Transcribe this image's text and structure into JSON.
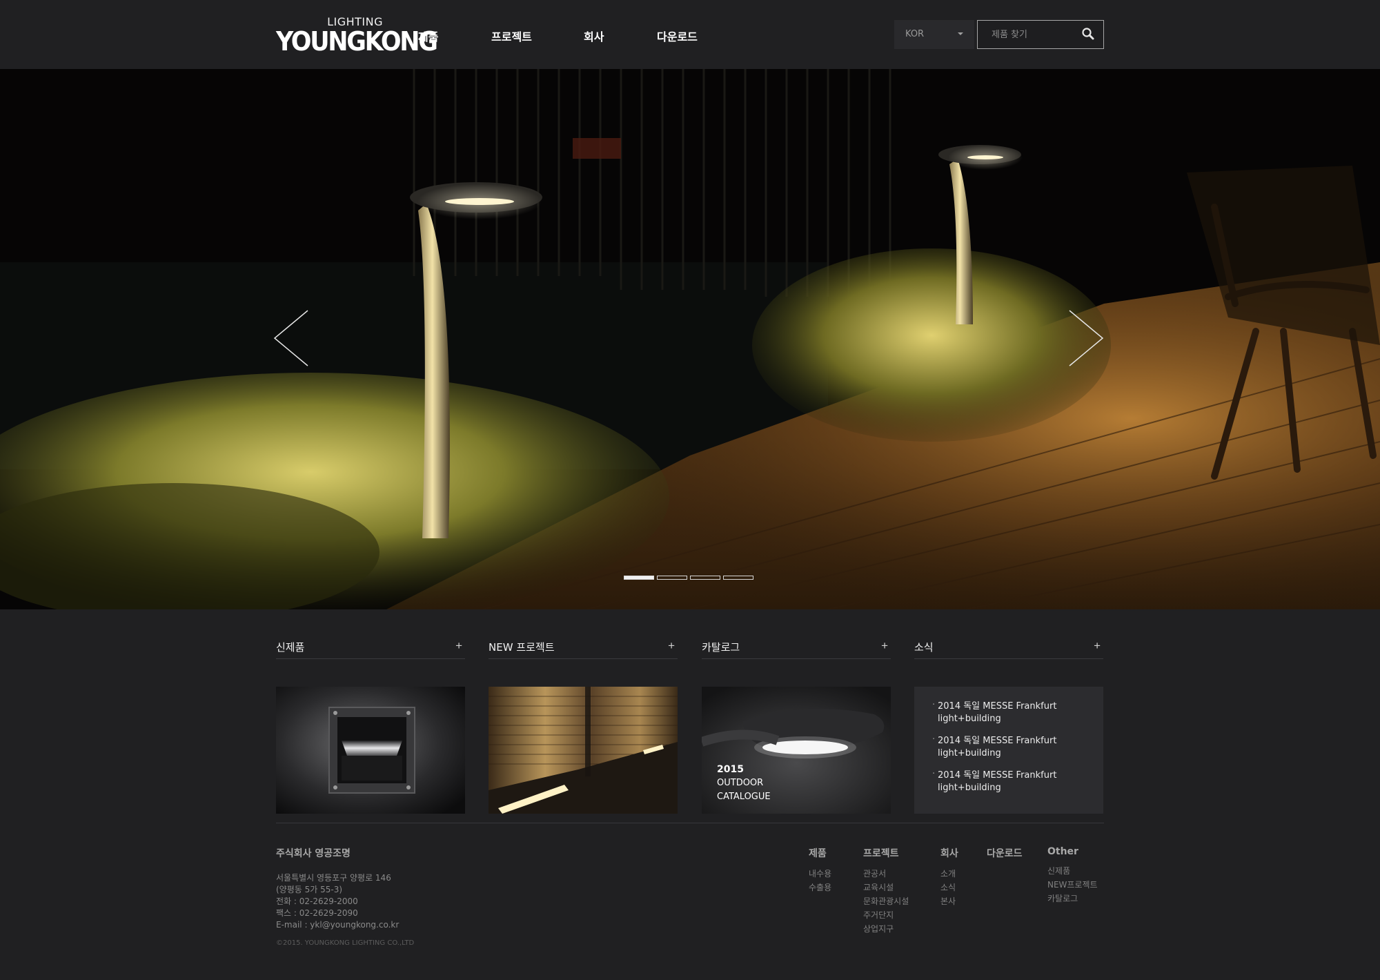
{
  "header": {
    "logo_small": "LIGHTING",
    "logo_big": "YOUNGKONG",
    "nav": [
      "제품",
      "프로젝트",
      "회사",
      "다운로드"
    ],
    "lang": "KOR",
    "search_placeholder": "제품 찾기"
  },
  "hero": {
    "slide_count": 4,
    "active_slide": 1
  },
  "sections": [
    {
      "title": "신제품",
      "plus": "+"
    },
    {
      "title": "NEW 프로젝트",
      "plus": "+"
    },
    {
      "title": "카탈로그",
      "plus": "+",
      "catalogue_year": "2015",
      "catalogue_line1": "OUTDOOR",
      "catalogue_line2": "CATALOGUE"
    },
    {
      "title": "소식",
      "plus": "+",
      "news": [
        {
          "line1": "2014 독일 MESSE Frankfurt",
          "line2": "light+building"
        },
        {
          "line1": "2014 독일 MESSE Frankfurt",
          "line2": "light+building"
        },
        {
          "line1": "2014 독일 MESSE Frankfurt",
          "line2": "light+building"
        }
      ]
    }
  ],
  "footer": {
    "company_name": "주식회사 영공조명",
    "address1": "서울특별시 영등포구 양평로 146",
    "address2": "(양평동 5가 55-3)",
    "phone": "전화 : 02-2629-2000",
    "fax": "팩스 : 02-2629-2090",
    "email": "E-mail : ykl@youngkong.co.kr",
    "copyright": "©2015. YOUNGKONG LIGHTING CO.,LTD",
    "columns": [
      {
        "head": "제품",
        "links": [
          "내수용",
          "수출용"
        ]
      },
      {
        "head": "프로젝트",
        "links": [
          "관공서",
          "교육시설",
          "문화관광시설",
          "주거단지",
          "상업지구"
        ]
      },
      {
        "head": "회사",
        "links": [
          "소개",
          "소식",
          "본사"
        ]
      },
      {
        "head": "다운로드",
        "links": []
      },
      {
        "head": "Other",
        "links": [
          "신제품",
          "NEW프로젝트",
          "카탈로그"
        ]
      }
    ]
  },
  "colors": {
    "background": "#202022",
    "news_panel": "#2c2c2f",
    "accent_light": "#e8d27a"
  },
  "icons": [
    "search-icon",
    "chevron-left-icon",
    "chevron-right-icon",
    "plus-icon",
    "caret-down-icon"
  ]
}
